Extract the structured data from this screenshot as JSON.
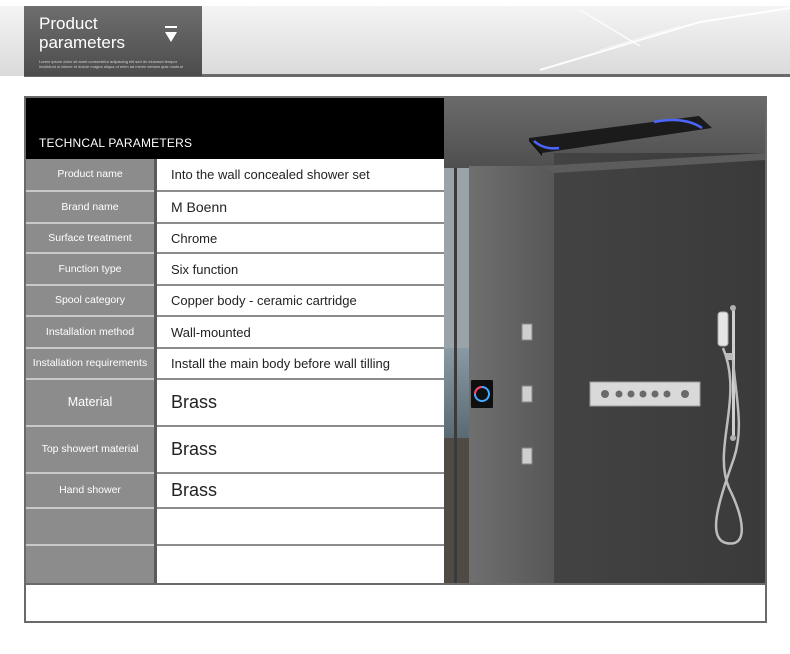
{
  "header": {
    "title": "Product parameters",
    "tiny_text": "Lorem ipsum dolor sit amet consectetur adipiscing elit sed do eiusmod tempor incididunt ut labore et dolore magna aliqua ut enim ad minim veniam quis nostrud",
    "arrow_icon": "triangle-down-icon"
  },
  "table": {
    "heading": "TECHNCAL PARAMETERS",
    "rows": [
      {
        "label": "Product name",
        "value": "Into the wall concealed shower set"
      },
      {
        "label": "Brand name",
        "value": "M Boenn"
      },
      {
        "label": "Surface treatment",
        "value": "Chrome"
      },
      {
        "label": "Function type",
        "value": "Six function"
      },
      {
        "label": "Spool category",
        "value": "Copper body - ceramic cartridge"
      },
      {
        "label": "Installation method",
        "value": "Wall-mounted"
      },
      {
        "label": "Installation requirements",
        "value": "Install the main body before wall tilling"
      },
      {
        "label": "Material",
        "value": "Brass"
      },
      {
        "label": "Top showert material",
        "value": "Brass"
      },
      {
        "label": "Hand shower",
        "value": "Brass"
      },
      {
        "label": "",
        "value": ""
      },
      {
        "label": "",
        "value": ""
      }
    ]
  },
  "colors": {
    "label_bg": "#8c8c8c",
    "heading_bg": "#000000",
    "frame": "#6a6a6a",
    "led_blue": "#4a66ff"
  }
}
